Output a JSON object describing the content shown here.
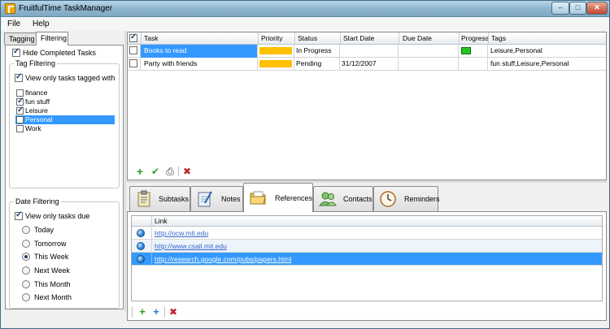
{
  "window": {
    "title": "FruitfulTime TaskManager",
    "min": "–",
    "max": "□",
    "close": "✕"
  },
  "menu": [
    "File",
    "Help"
  ],
  "left_tabs": [
    "Tagging",
    "Filtering"
  ],
  "filters": {
    "hide_completed": "Hide Completed Tasks",
    "tag_group": "Tag Filtering",
    "only_tagged": "View only tasks tagged with",
    "tags": [
      {
        "name": "finance",
        "checked": false
      },
      {
        "name": "fun stuff",
        "checked": true
      },
      {
        "name": "Leisure",
        "checked": true
      },
      {
        "name": "Personal",
        "checked": false,
        "selected": true
      },
      {
        "name": "Work",
        "checked": false
      }
    ],
    "date_group": "Date Filtering",
    "only_due": "View only tasks due",
    "due_options": [
      "Today",
      "Tomorrow",
      "This Week",
      "Next Week",
      "This Month",
      "Next Month"
    ],
    "due_selected": "This Week"
  },
  "task_grid": {
    "headers": [
      "Task",
      "Priority",
      "Status",
      "Start Date",
      "Due Date",
      "Progress",
      "Tags"
    ],
    "rows": [
      {
        "task": "Books to read",
        "priority_color": "#ffc000",
        "status": "In Progress",
        "start": "",
        "due": "",
        "progress_color": "#22c422",
        "tags": "Leisure,Personal"
      },
      {
        "task": "Party with friends",
        "priority_color": "#ffc000",
        "status": "Pending",
        "start": "31/12/2007",
        "due": "",
        "progress_color": "",
        "tags": "fun stuff,Leisure,Personal"
      }
    ]
  },
  "task_toolbar": {
    "add": "+",
    "complete": "✔",
    "print": "⎙",
    "delete": "✖"
  },
  "bottom_tabs": [
    "Subtasks",
    "Notes",
    "References",
    "Contacts",
    "Reminders"
  ],
  "active_bottom_tab": "References",
  "references": {
    "header": "Link",
    "links": [
      "http://ocw.mit.edu",
      "http://www.csail.mit.edu",
      "http://research.google.com/pubs/papers.html"
    ]
  },
  "ref_toolbar": {
    "add": "+",
    "add_web": "+",
    "delete": "✖"
  },
  "colors": {
    "selection": "#3399ff",
    "priority_high": "#ffc000",
    "progress": "#22c422"
  }
}
